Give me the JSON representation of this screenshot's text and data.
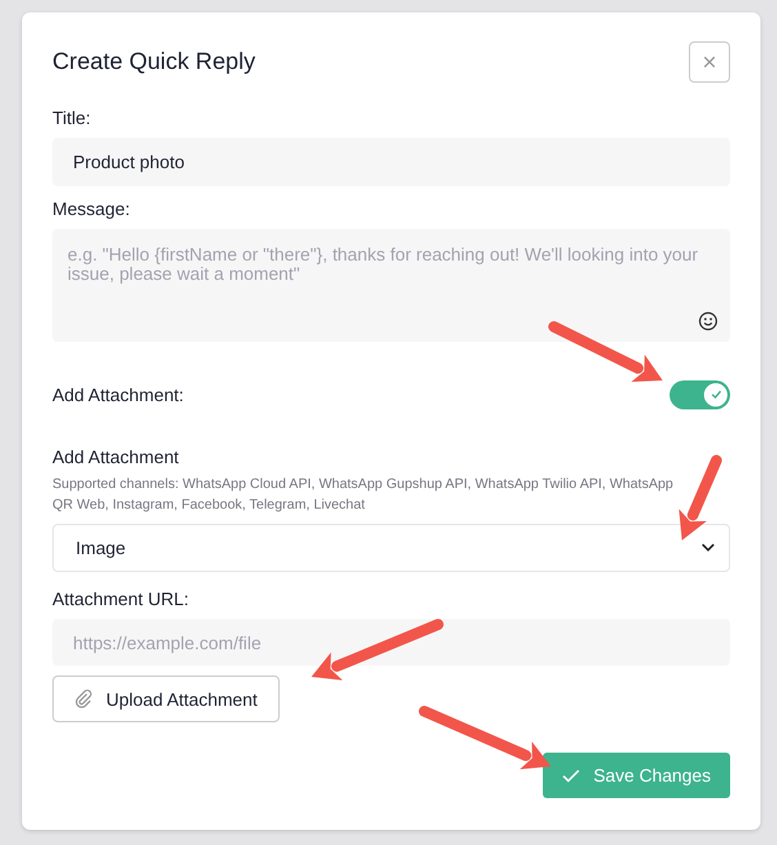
{
  "dialog": {
    "title": "Create Quick Reply",
    "close_label": "×"
  },
  "title_field": {
    "label": "Title:",
    "value": "Product photo"
  },
  "message_field": {
    "label": "Message:",
    "placeholder": "e.g. \"Hello {firstName or \"there\"}, thanks for reaching out! We'll looking into your issue, please wait a moment\""
  },
  "attachment_toggle": {
    "label": "Add Attachment:",
    "on": true
  },
  "attachment_type": {
    "label": "Add Attachment",
    "hint": "Supported channels: WhatsApp Cloud API, WhatsApp Gupshup API, WhatsApp Twilio API, WhatsApp QR Web, Instagram, Facebook, Telegram, Livechat",
    "value": "Image"
  },
  "attachment_url": {
    "label": "Attachment URL:",
    "placeholder": "https://example.com/file"
  },
  "buttons": [
    {
      "kind": "upload",
      "label": "Upload Attachment"
    },
    {
      "kind": "save",
      "label": "Save Changes"
    }
  ]
}
